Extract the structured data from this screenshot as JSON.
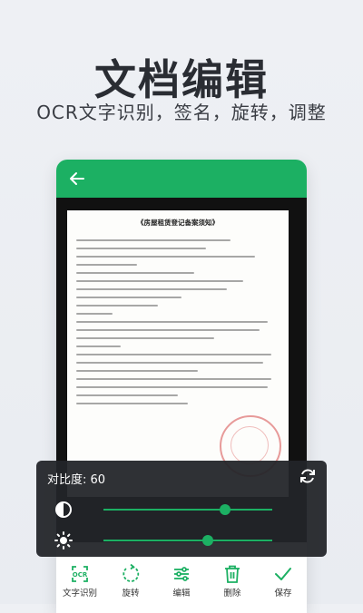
{
  "promo": {
    "title": "文档编辑",
    "subtitle": "OCR文字识别，签名，旋转，调整"
  },
  "appbar": {
    "back_icon": "arrow-left-icon",
    "color": "#1cb063"
  },
  "document": {
    "title": "《房屋租赁登记备案须知》"
  },
  "adjust_panel": {
    "contrast_label": "对比度: 60",
    "contrast_value": 60,
    "contrast_fraction": 0.72,
    "brightness_fraction": 0.62,
    "reset_icon": "refresh-icon",
    "contrast_icon": "contrast-icon",
    "brightness_icon": "sun-icon"
  },
  "toolbar": {
    "items": [
      {
        "label": "文字识别",
        "icon": "ocr-icon"
      },
      {
        "label": "旋转",
        "icon": "rotate-icon"
      },
      {
        "label": "编辑",
        "icon": "sliders-icon"
      },
      {
        "label": "删除",
        "icon": "trash-icon"
      },
      {
        "label": "保存",
        "icon": "check-icon"
      }
    ]
  }
}
